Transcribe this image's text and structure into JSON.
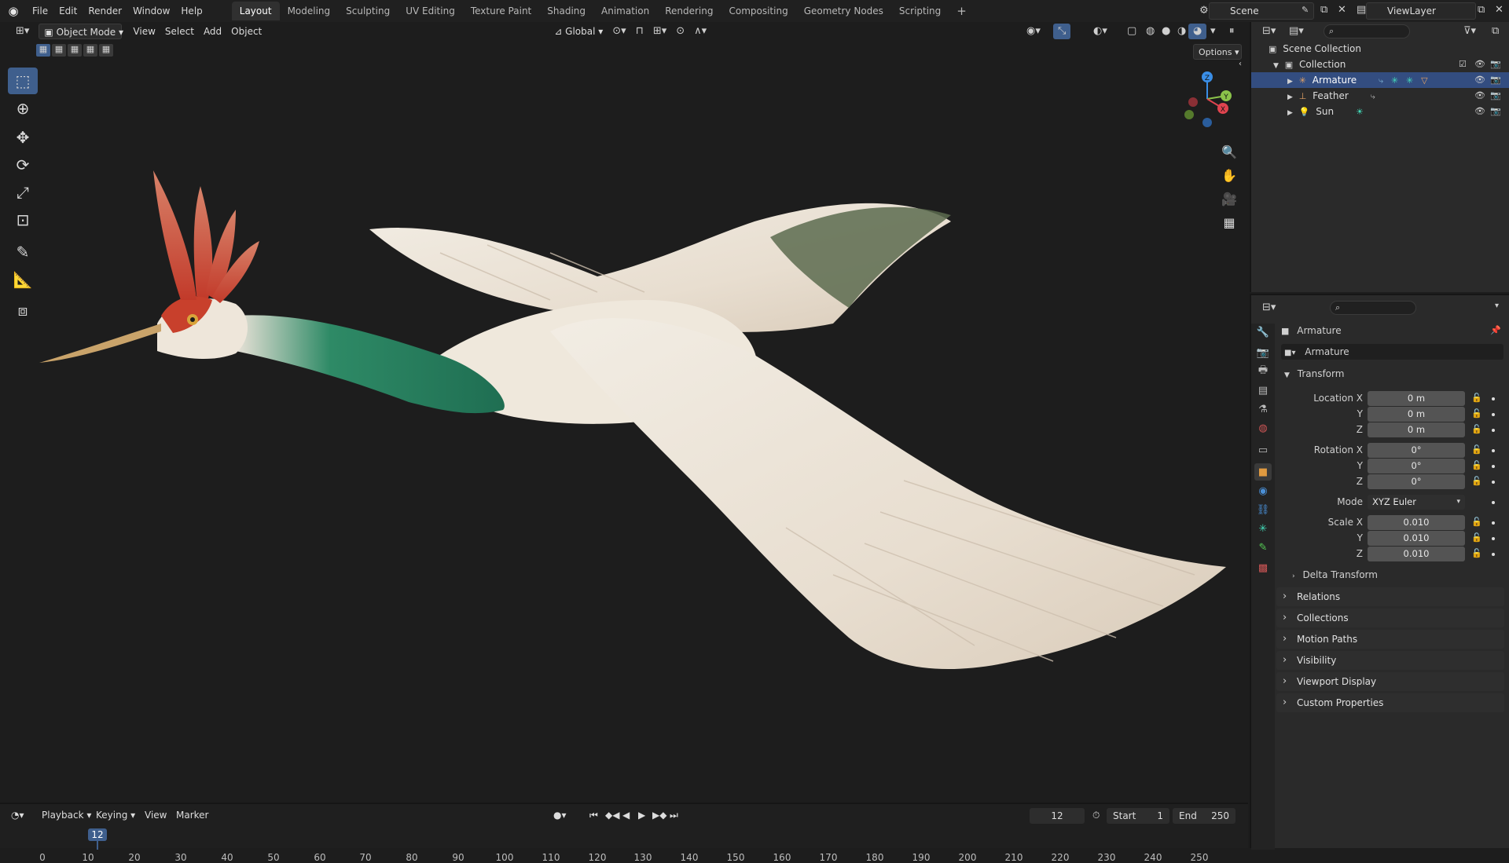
{
  "topbar": {
    "menus": [
      "File",
      "Edit",
      "Render",
      "Window",
      "Help"
    ],
    "workspaces": [
      "Layout",
      "Modeling",
      "Sculpting",
      "UV Editing",
      "Texture Paint",
      "Shading",
      "Animation",
      "Rendering",
      "Compositing",
      "Geometry Nodes",
      "Scripting"
    ],
    "active_workspace": "Layout",
    "add_tab": "+",
    "scene": "Scene",
    "view_layer": "ViewLayer"
  },
  "viewport_header": {
    "mode": "Object Mode",
    "menus": [
      "View",
      "Select",
      "Add",
      "Object"
    ],
    "orientation": "Global",
    "options": "Options"
  },
  "gizmo": {
    "x": "X",
    "y": "Y",
    "z": "Z"
  },
  "outliner": {
    "root": "Scene Collection",
    "collection": "Collection",
    "items": [
      {
        "name": "Armature",
        "selected": true
      },
      {
        "name": "Feather",
        "selected": false
      },
      {
        "name": "Sun",
        "selected": false
      }
    ]
  },
  "properties": {
    "object_name": "Armature",
    "data_name": "Armature",
    "transform": {
      "title": "Transform",
      "location_label": "Location X",
      "rotation_label": "Rotation X",
      "scale_label": "Scale X",
      "y_label": "Y",
      "z_label": "Z",
      "mode_label": "Mode",
      "location": [
        "0 m",
        "0 m",
        "0 m"
      ],
      "rotation": [
        "0°",
        "0°",
        "0°"
      ],
      "mode": "XYZ Euler",
      "scale": [
        "0.010",
        "0.010",
        "0.010"
      ]
    },
    "delta_transform": "Delta Transform",
    "panels": [
      "Relations",
      "Collections",
      "Motion Paths",
      "Visibility",
      "Viewport Display",
      "Custom Properties"
    ]
  },
  "timeline": {
    "menus": [
      "Playback",
      "Keying",
      "View",
      "Marker"
    ],
    "current_frame": "12",
    "start_label": "Start",
    "start": "1",
    "end_label": "End",
    "end": "250",
    "ticks": [
      "0",
      "10",
      "20",
      "30",
      "40",
      "50",
      "60",
      "70",
      "80",
      "90",
      "100",
      "110",
      "120",
      "130",
      "140",
      "150",
      "160",
      "170",
      "180",
      "190",
      "200",
      "210",
      "220",
      "230",
      "240",
      "250"
    ]
  },
  "colors": {
    "accent": "#3f5f8d",
    "selection": "#334d80",
    "x_axis": "#e0444f",
    "y_axis": "#8bc34a",
    "z_axis": "#3a8ee6"
  }
}
